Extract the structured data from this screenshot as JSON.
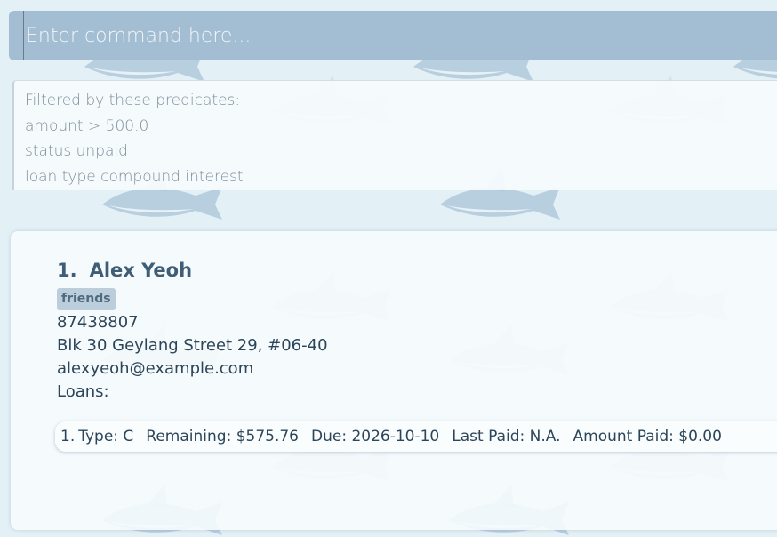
{
  "command": {
    "placeholder": "Enter command here..."
  },
  "result_display": {
    "lines": [
      "Filtered by these predicates:",
      "amount > 500.0",
      "status unpaid",
      "loan type compound interest"
    ]
  },
  "persons": [
    {
      "index": "1.",
      "name": "Alex Yeoh",
      "tags": [
        "friends"
      ],
      "phone": "87438807",
      "address": "Blk 30 Geylang Street 29, #06-40",
      "email": "alexyeoh@example.com",
      "loans_label": "Loans:",
      "loans": [
        {
          "index": "1.",
          "type": "Type: C",
          "remaining": "Remaining: $575.76",
          "due": "Due: 2026-10-10",
          "last_paid": "Last Paid: N.A.",
          "amount_paid": "Amount Paid: $0.00"
        }
      ]
    }
  ],
  "colors": {
    "command_bar": "#a3bdd3",
    "background": "#e3f1f7",
    "name_text": "#3f5d75",
    "tag_bg": "#bccddb"
  },
  "icons": [
    "shark-icon"
  ]
}
